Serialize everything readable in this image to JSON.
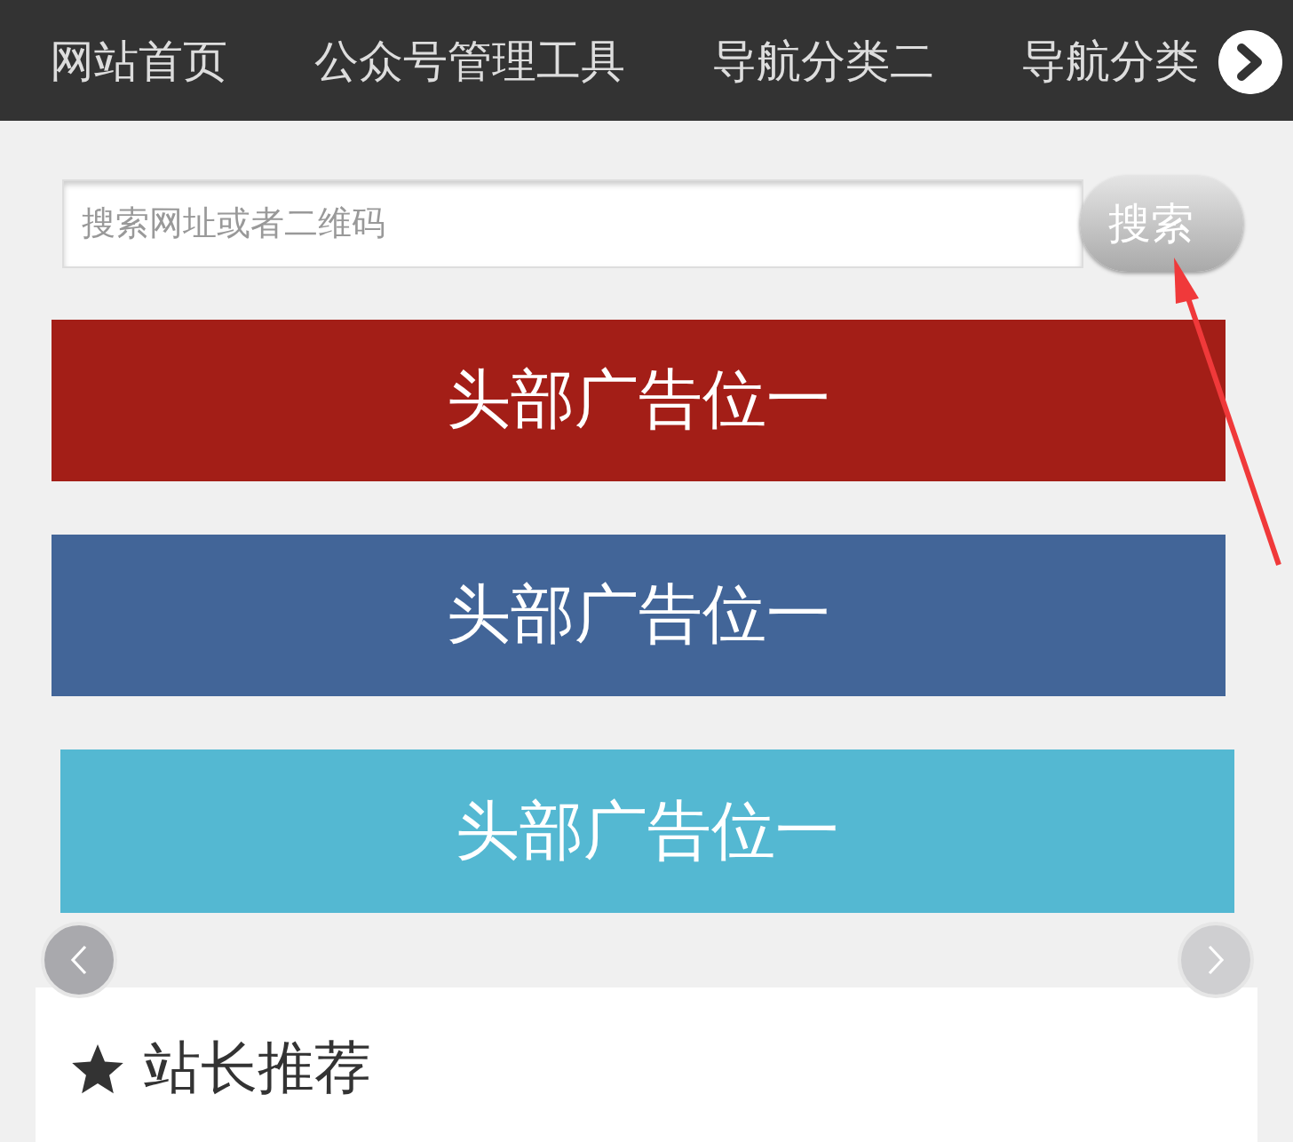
{
  "nav": {
    "items": [
      {
        "label": "网站首页"
      },
      {
        "label": "公众号管理工具"
      },
      {
        "label": "导航分类二"
      },
      {
        "label": "导航分类"
      }
    ]
  },
  "search": {
    "placeholder": "搜索网址或者二维码",
    "button": "搜索"
  },
  "banners": [
    {
      "text": "头部广告位一",
      "color": "#a31e17"
    },
    {
      "text": "头部广告位一",
      "color": "#426598"
    },
    {
      "text": "头部广告位一",
      "color": "#54b8d2"
    }
  ],
  "section": {
    "title": "站长推荐"
  }
}
